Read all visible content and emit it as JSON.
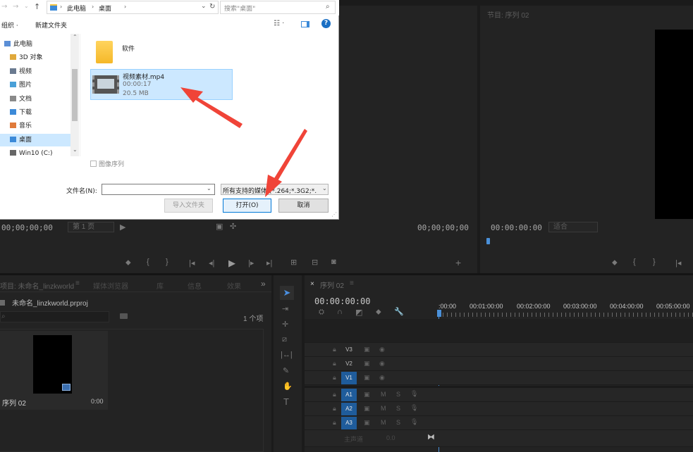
{
  "dialog": {
    "breadcrumb": [
      "此电脑",
      "桌面"
    ],
    "search_placeholder": "搜索\"桌面\"",
    "toolbar": {
      "organize": "组织 ·",
      "new_folder": "新建文件夹"
    },
    "nav_items": [
      {
        "label": "此电脑",
        "icon": "pc-icon"
      },
      {
        "label": "3D 对象",
        "icon": "3d-objects-icon"
      },
      {
        "label": "视频",
        "icon": "videos-icon"
      },
      {
        "label": "图片",
        "icon": "pictures-icon"
      },
      {
        "label": "文档",
        "icon": "documents-icon"
      },
      {
        "label": "下载",
        "icon": "downloads-icon"
      },
      {
        "label": "音乐",
        "icon": "music-icon"
      },
      {
        "label": "桌面",
        "icon": "desktop-icon",
        "selected": true
      },
      {
        "label": "Win10 (C:)",
        "icon": "drive-icon"
      }
    ],
    "files": [
      {
        "name": "软件",
        "type": "folder"
      },
      {
        "name": "视频素材.mp4",
        "duration": "00:00:17",
        "size": "20.5 MB",
        "type": "video",
        "selected": true
      }
    ],
    "image_sequence_label": "图像序列",
    "filename_label": "文件名(N):",
    "filename_value": "",
    "filter_value": "所有支持的媒体 (*.264;*.3G2;*.",
    "buttons": {
      "import_folder": "导入文件夹",
      "open": "打开(O)",
      "cancel": "取消"
    }
  },
  "source_monitor": {
    "timecode_left": "00;00;00;00",
    "page_select": "第 1 页",
    "timecode_right": "00;00;00;00"
  },
  "program_monitor": {
    "title": "节目: 序列 02",
    "timecode": "00:00:00:00",
    "fit": "适合"
  },
  "project_panel": {
    "tabs": [
      "项目: 未命名_linzkworld",
      "媒体浏览器",
      "库",
      "信息",
      "效果"
    ],
    "project_file": "未命名_linzkworld.prproj",
    "item_count": "1 个项",
    "clip_name": "序列 02",
    "clip_duration": "0:00"
  },
  "timeline": {
    "tab": "序列 02",
    "timecode": "00:00:00:00",
    "ruler": [
      ":00:00",
      "00:01:00:00",
      "00:02:00:00",
      "00:03:00:00",
      "00:04:00:00",
      "00:05:00:00"
    ],
    "video_tracks": [
      "V3",
      "V2",
      "V1"
    ],
    "audio_tracks": [
      "A1",
      "A2",
      "A3"
    ],
    "master_label": "主声道",
    "master_value": "0.0",
    "mute_label": "M",
    "solo_label": "S"
  },
  "colors": {
    "accent": "#1f5c9b",
    "playhead": "#4a90d9",
    "annotation": "#f04438"
  }
}
